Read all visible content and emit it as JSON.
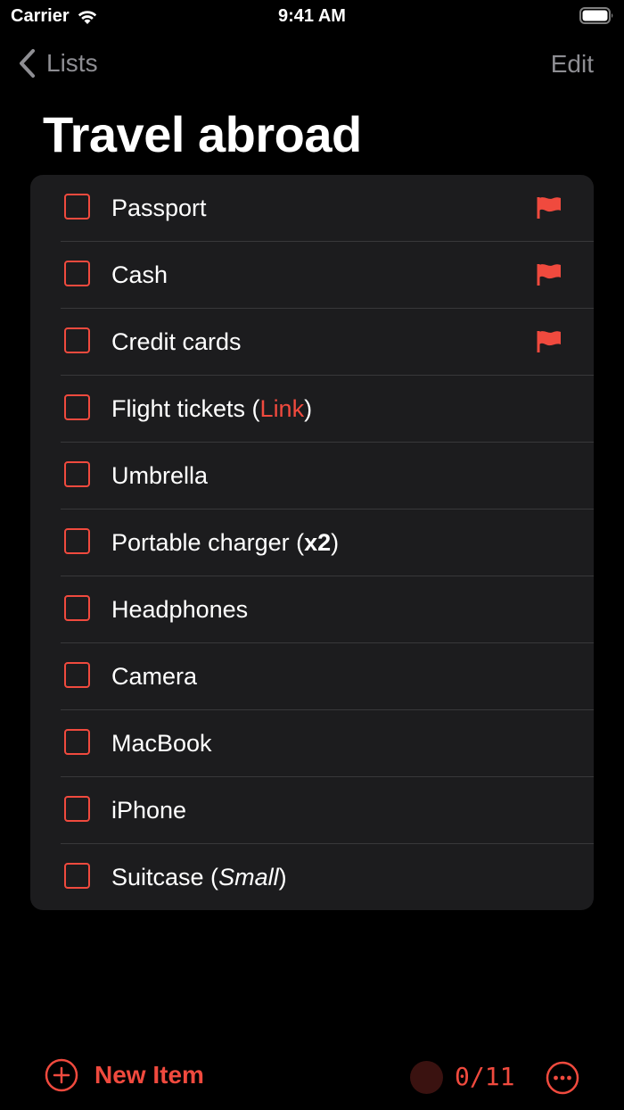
{
  "status_bar": {
    "carrier": "Carrier",
    "time": "9:41 AM"
  },
  "nav": {
    "back_label": "Lists",
    "edit_label": "Edit"
  },
  "title": "Travel abroad",
  "items": [
    {
      "label": "Passport",
      "flagged": true
    },
    {
      "label": "Cash",
      "flagged": true
    },
    {
      "label": "Credit cards",
      "flagged": true
    },
    {
      "label_before": "Flight tickets (",
      "link": "Link",
      "label_after": ")",
      "flagged": false
    },
    {
      "label": "Umbrella",
      "flagged": false
    },
    {
      "label_before": "Portable charger (",
      "bold": "x2",
      "label_after": ")",
      "flagged": false
    },
    {
      "label": "Headphones",
      "flagged": false
    },
    {
      "label": "Camera",
      "flagged": false
    },
    {
      "label": "MacBook",
      "flagged": false
    },
    {
      "label": "iPhone",
      "flagged": false
    },
    {
      "label_before": "Suitcase (",
      "italic": "Small",
      "label_after": ")",
      "flagged": false
    }
  ],
  "toolbar": {
    "new_item_label": "New Item",
    "counter": "0/11"
  },
  "colors": {
    "accent": "#f04a3e",
    "background": "#000000",
    "card": "#1c1c1e",
    "secondary": "#8e8e93"
  }
}
